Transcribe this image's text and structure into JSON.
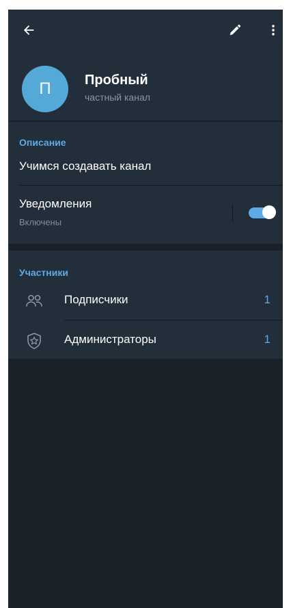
{
  "header": {
    "title": "Пробный",
    "subtitle": "частный канал",
    "avatar_letter": "П"
  },
  "info": {
    "section_title": "Описание",
    "description": "Учимся создавать канал",
    "notifications_label": "Уведомления",
    "notifications_status": "Включены",
    "notifications_enabled": true
  },
  "members": {
    "section_title": "Участники",
    "items": [
      {
        "label": "Подписчики",
        "count": "1",
        "icon": "subscribers-icon"
      },
      {
        "label": "Администраторы",
        "count": "1",
        "icon": "admin-shield-icon"
      }
    ]
  },
  "colors": {
    "accent": "#5ea9e6",
    "avatar": "#54a9d8",
    "background": "#1b2129",
    "surface": "#232e3b"
  }
}
